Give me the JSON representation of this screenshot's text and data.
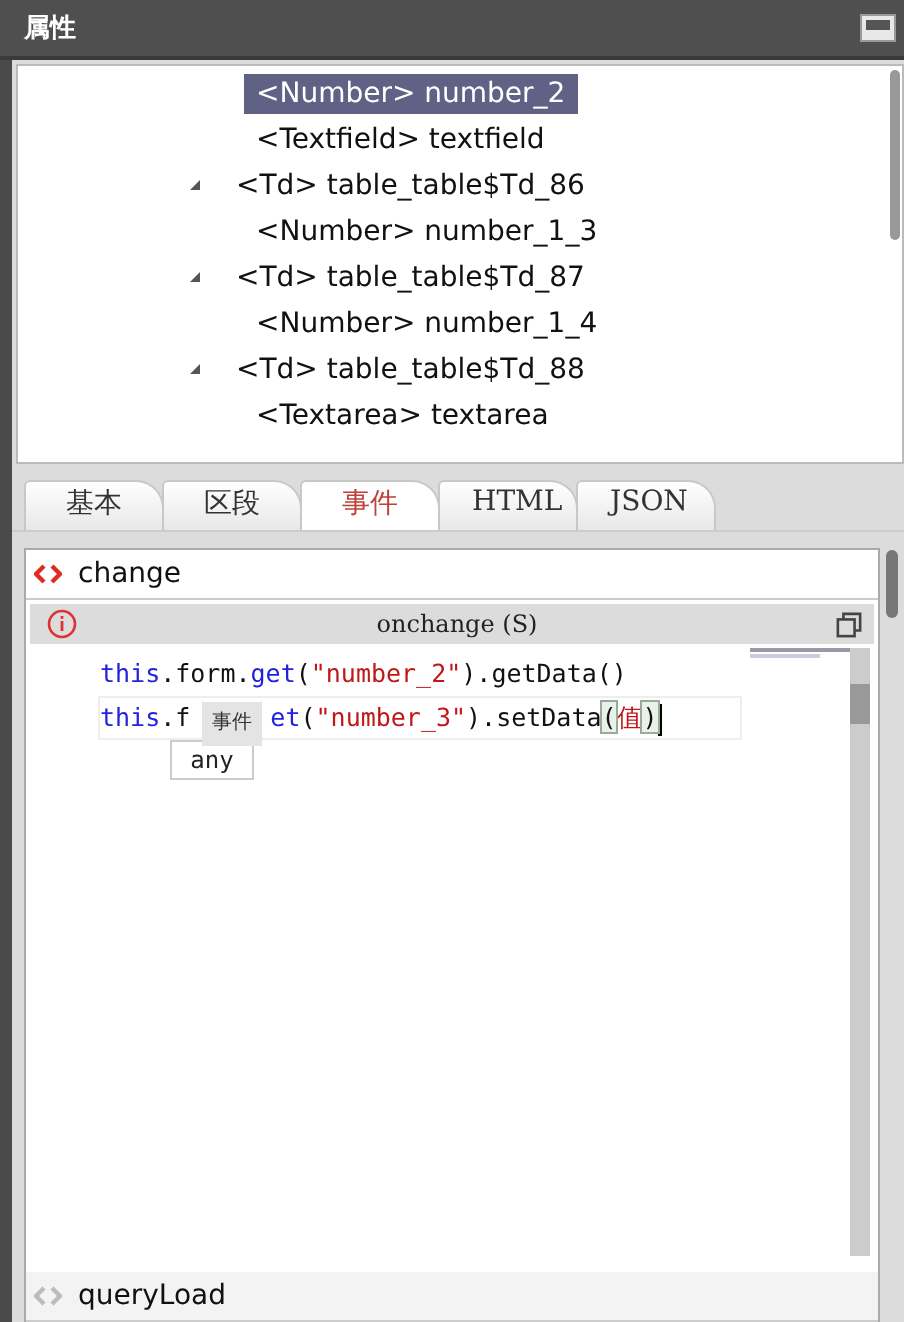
{
  "panel": {
    "title": "属性"
  },
  "tree": {
    "leading_items": [
      {
        "label": "<Number> number_2",
        "selected": true
      },
      {
        "label": "<Textfield> textfield",
        "selected": false
      }
    ],
    "items": [
      {
        "label": "<Td> table_table$Td_86",
        "selected": false,
        "expanded": true,
        "children": [
          {
            "label": "<Number> number_1_3",
            "selected": false
          }
        ]
      },
      {
        "label": "<Td> table_table$Td_87",
        "selected": false,
        "expanded": true,
        "children": [
          {
            "label": "<Number> number_1_4",
            "selected": false
          }
        ]
      },
      {
        "label": "<Td> table_table$Td_88",
        "selected": false,
        "expanded": true,
        "children": [
          {
            "label": "<Textarea> textarea",
            "selected": false
          }
        ]
      }
    ]
  },
  "tabs": [
    {
      "label": "基本",
      "selected": false
    },
    {
      "label": "区段",
      "selected": false
    },
    {
      "label": "事件",
      "selected": true
    },
    {
      "label": "HTML",
      "selected": false
    },
    {
      "label": "JSON",
      "selected": false
    }
  ],
  "events": [
    {
      "name": "change",
      "active": true,
      "editor": {
        "title": "onchange (S)",
        "lines": [
          {
            "current": false,
            "before": [
              {
                "kind": "keyword",
                "text": "this"
              },
              {
                "kind": "plain",
                "text": ".form."
              },
              {
                "kind": "keyword",
                "text": "get"
              },
              {
                "kind": "plain",
                "text": "("
              },
              {
                "kind": "string",
                "text": "\"number_2\""
              },
              {
                "kind": "plain",
                "text": ").getData()"
              }
            ]
          },
          {
            "current": true,
            "before": [
              {
                "kind": "keyword",
                "text": "this"
              },
              {
                "kind": "plain",
                "text": ".f"
              }
            ],
            "tooltip": "事件",
            "after": [
              {
                "kind": "keyword",
                "text": "et"
              },
              {
                "kind": "plain",
                "text": "("
              },
              {
                "kind": "string",
                "text": "\"number_3\""
              },
              {
                "kind": "plain",
                "text": ").setData"
              },
              {
                "kind": "bracket",
                "text": "("
              },
              {
                "kind": "string",
                "text": "值"
              },
              {
                "kind": "bracket",
                "text": ")"
              }
            ]
          }
        ],
        "completion": "any"
      }
    },
    {
      "name": "queryLoad",
      "active": false
    }
  ]
}
